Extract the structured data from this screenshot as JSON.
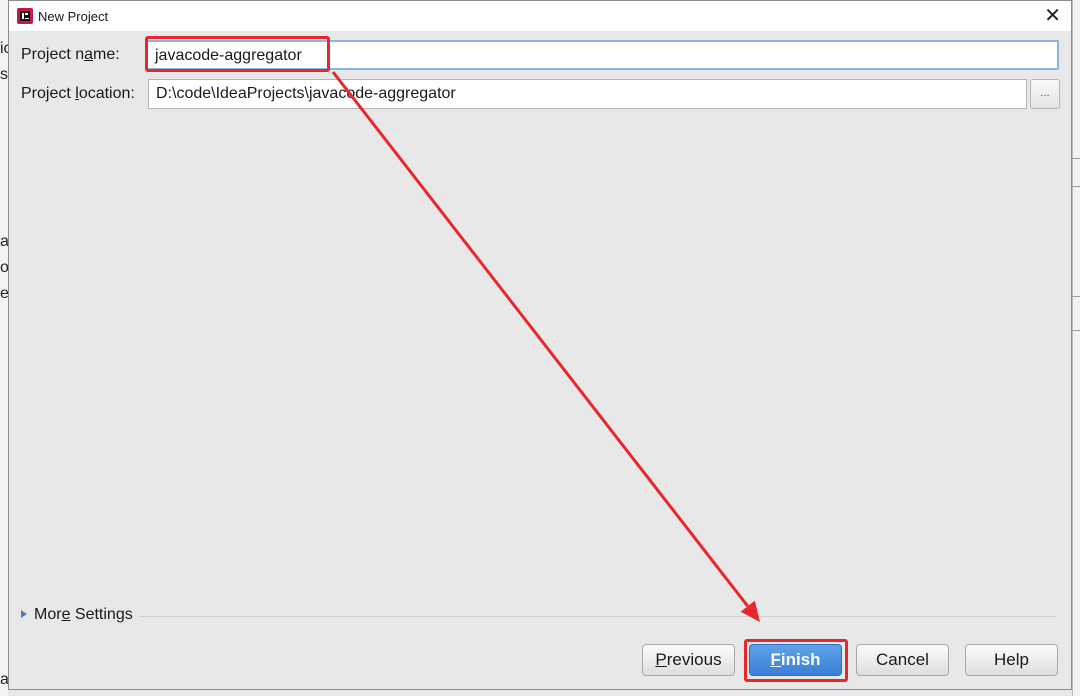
{
  "background": {
    "left_fragments": [
      "ic",
      "sr",
      "a",
      "o",
      "er",
      "al"
    ]
  },
  "dialog": {
    "title": "New Project",
    "close_glyph": "✕",
    "app_icon": "intellij-idea-icon"
  },
  "form": {
    "project_name_label_pre": "Project n",
    "project_name_label_mnemonic": "a",
    "project_name_label_post": "me:",
    "project_name_value": "javacode-aggregator",
    "project_location_label_pre": "Project ",
    "project_location_label_mnemonic": "l",
    "project_location_label_post": "ocation:",
    "project_location_value": "D:\\code\\IdeaProjects\\javacode-aggregator",
    "browse_label": "..."
  },
  "more_settings": {
    "label_pre": "Mor",
    "label_mnemonic": "e",
    "label_post": " Settings"
  },
  "buttons": {
    "previous_mnemonic": "P",
    "previous_rest": "revious",
    "finish_mnemonic": "F",
    "finish_rest": "inish",
    "cancel": "Cancel",
    "help": "Help"
  },
  "annotation_color": "#e8262c",
  "accent_color": "#3a7fd4"
}
